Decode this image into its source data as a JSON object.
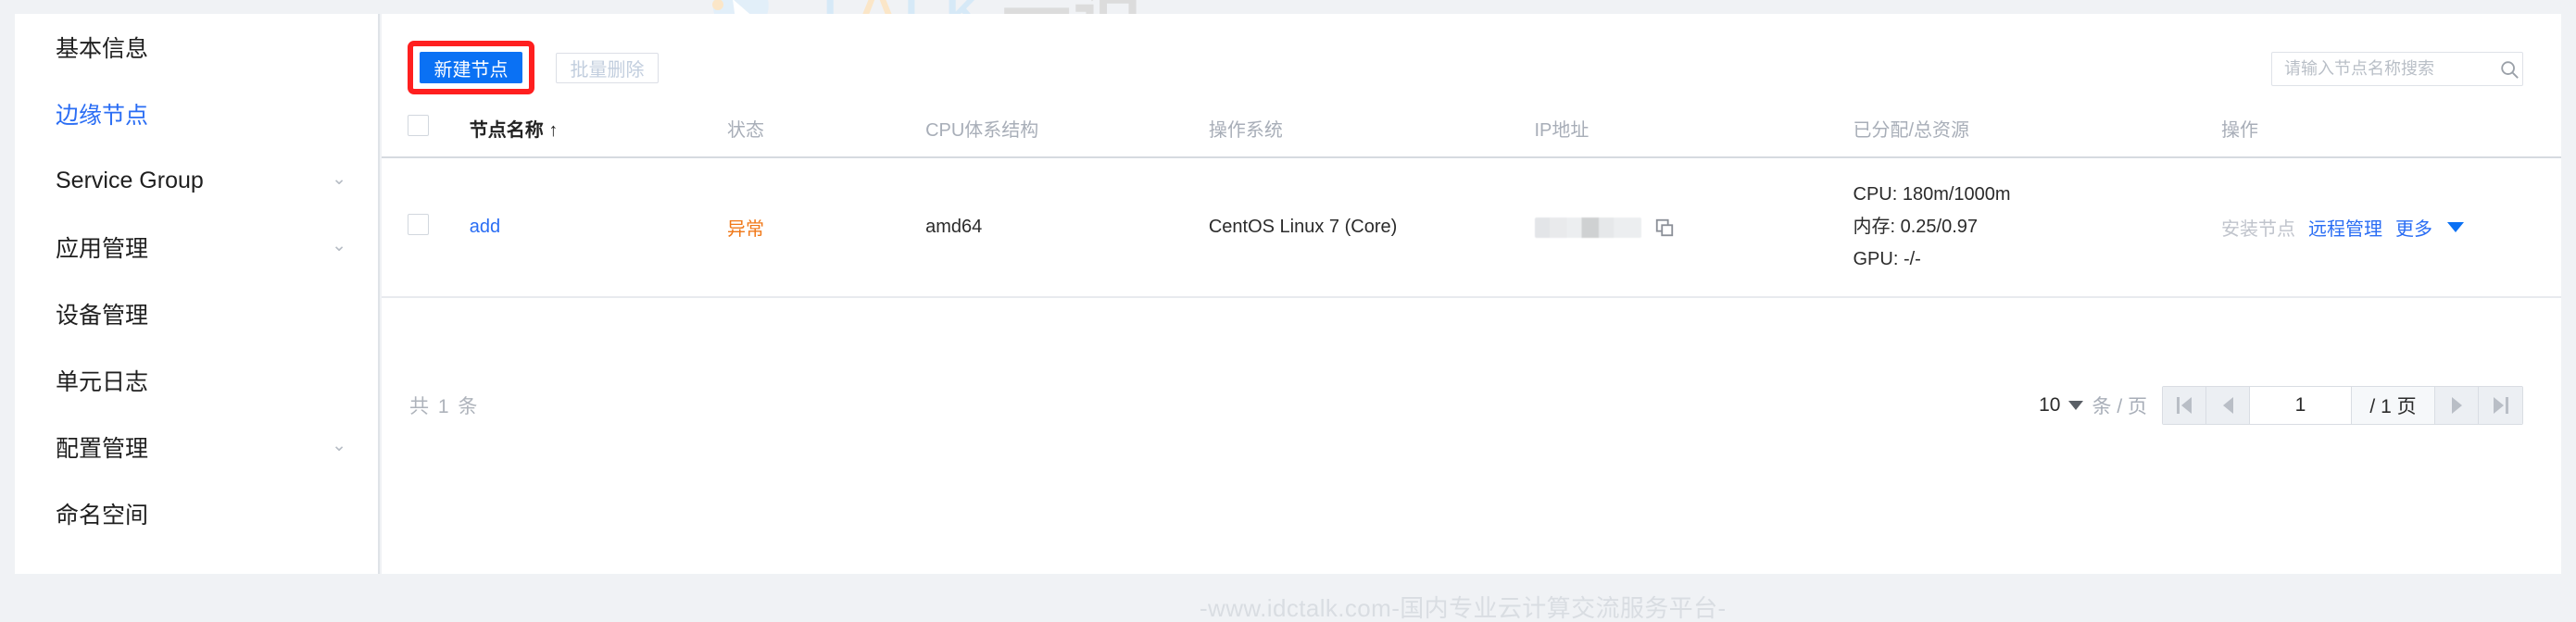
{
  "sidebar": {
    "items": [
      {
        "label": "基本信息",
        "active": false,
        "expandable": false
      },
      {
        "label": "边缘节点",
        "active": true,
        "expandable": false
      },
      {
        "label": "Service Group",
        "active": false,
        "expandable": true
      },
      {
        "label": "应用管理",
        "active": false,
        "expandable": true
      },
      {
        "label": "设备管理",
        "active": false,
        "expandable": false
      },
      {
        "label": "单元日志",
        "active": false,
        "expandable": false
      },
      {
        "label": "配置管理",
        "active": false,
        "expandable": true
      },
      {
        "label": "命名空间",
        "active": false,
        "expandable": false
      }
    ]
  },
  "toolbar": {
    "create_label": "新建节点",
    "batch_delete_label": "批量删除",
    "search_placeholder": "请输入节点名称搜索",
    "search_value": "",
    "highlight_color": "#ff1f1f",
    "primary_color": "#0a71f4"
  },
  "table": {
    "headers": [
      {
        "label": "",
        "key": "checkbox"
      },
      {
        "label": "节点名称",
        "key": "name",
        "sort": "↑",
        "sorted": true
      },
      {
        "label": "状态",
        "key": "state"
      },
      {
        "label": "CPU体系结构",
        "key": "arch"
      },
      {
        "label": "操作系统",
        "key": "os"
      },
      {
        "label": "IP地址",
        "key": "ip"
      },
      {
        "label": "已分配/总资源",
        "key": "resource"
      },
      {
        "label": "操作",
        "key": "ops"
      }
    ],
    "rows": [
      {
        "name": "add",
        "state": "异常",
        "state_color": "#f07818",
        "arch": "amd64",
        "os": "CentOS Linux 7 (Core)",
        "ip": "",
        "resource": [
          "CPU: 180m/1000m",
          "内存: 0.25/0.97",
          "GPU: -/-"
        ],
        "ops": [
          {
            "label": "安装节点",
            "disabled": true
          },
          {
            "label": "远程管理",
            "disabled": false
          },
          {
            "label": "更多",
            "disabled": false,
            "caret": true
          }
        ]
      }
    ]
  },
  "footer": {
    "total_text": "共 1 条",
    "page_size": "10",
    "page_size_unit": "条 / 页",
    "current_page": "1",
    "total_pages": "/ 1 页"
  },
  "watermark": {
    "brand_t": "T",
    "brand_a": "A",
    "brand_lk": "LK",
    "brand_cn": "云说",
    "url": "-www.idctalk.com-国内专业云计算交流服务平台-"
  }
}
